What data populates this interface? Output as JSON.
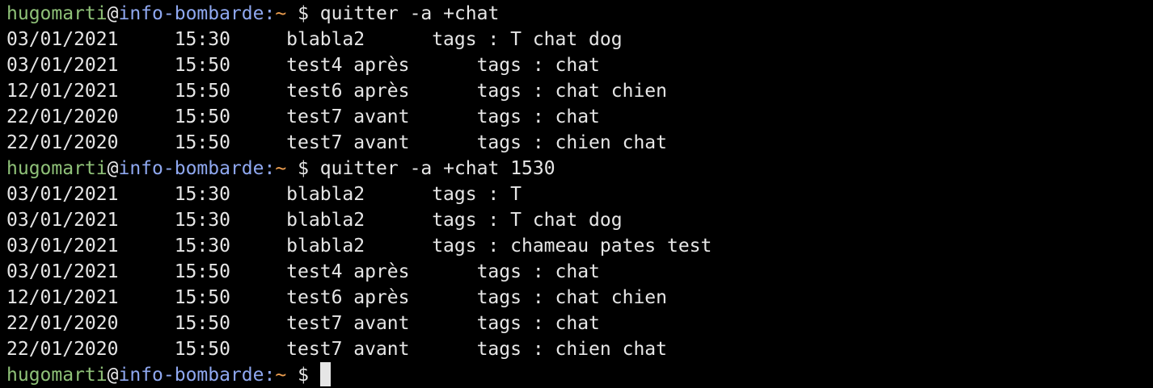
{
  "prompt": {
    "user": "hugomarti",
    "at": "@",
    "host": "info-bombarde",
    "colon": ":",
    "path": "~",
    "symbol": "$"
  },
  "colors": {
    "background": "#000000",
    "text": "#e6e6e6",
    "user": "#8fc178",
    "host": "#8fa8f0",
    "path": "#f0a050"
  },
  "blocks": [
    {
      "command": "quitter -a +chat",
      "output": [
        "03/01/2021     15:30     blabla2      tags : T chat dog",
        "03/01/2021     15:50     test4 après      tags : chat",
        "12/01/2021     15:50     test6 après      tags : chat chien",
        "22/01/2020     15:50     test7 avant      tags : chat",
        "22/01/2020     15:50     test7 avant      tags : chien chat"
      ]
    },
    {
      "command": "quitter -a +chat 1530",
      "output": [
        "03/01/2021     15:30     blabla2      tags : T",
        "03/01/2021     15:30     blabla2      tags : T chat dog",
        "03/01/2021     15:30     blabla2      tags : chameau pates test",
        "03/01/2021     15:50     test4 après      tags : chat",
        "12/01/2021     15:50     test6 après      tags : chat chien",
        "22/01/2020     15:50     test7 avant      tags : chat",
        "22/01/2020     15:50     test7 avant      tags : chien chat"
      ]
    }
  ],
  "current_input": ""
}
